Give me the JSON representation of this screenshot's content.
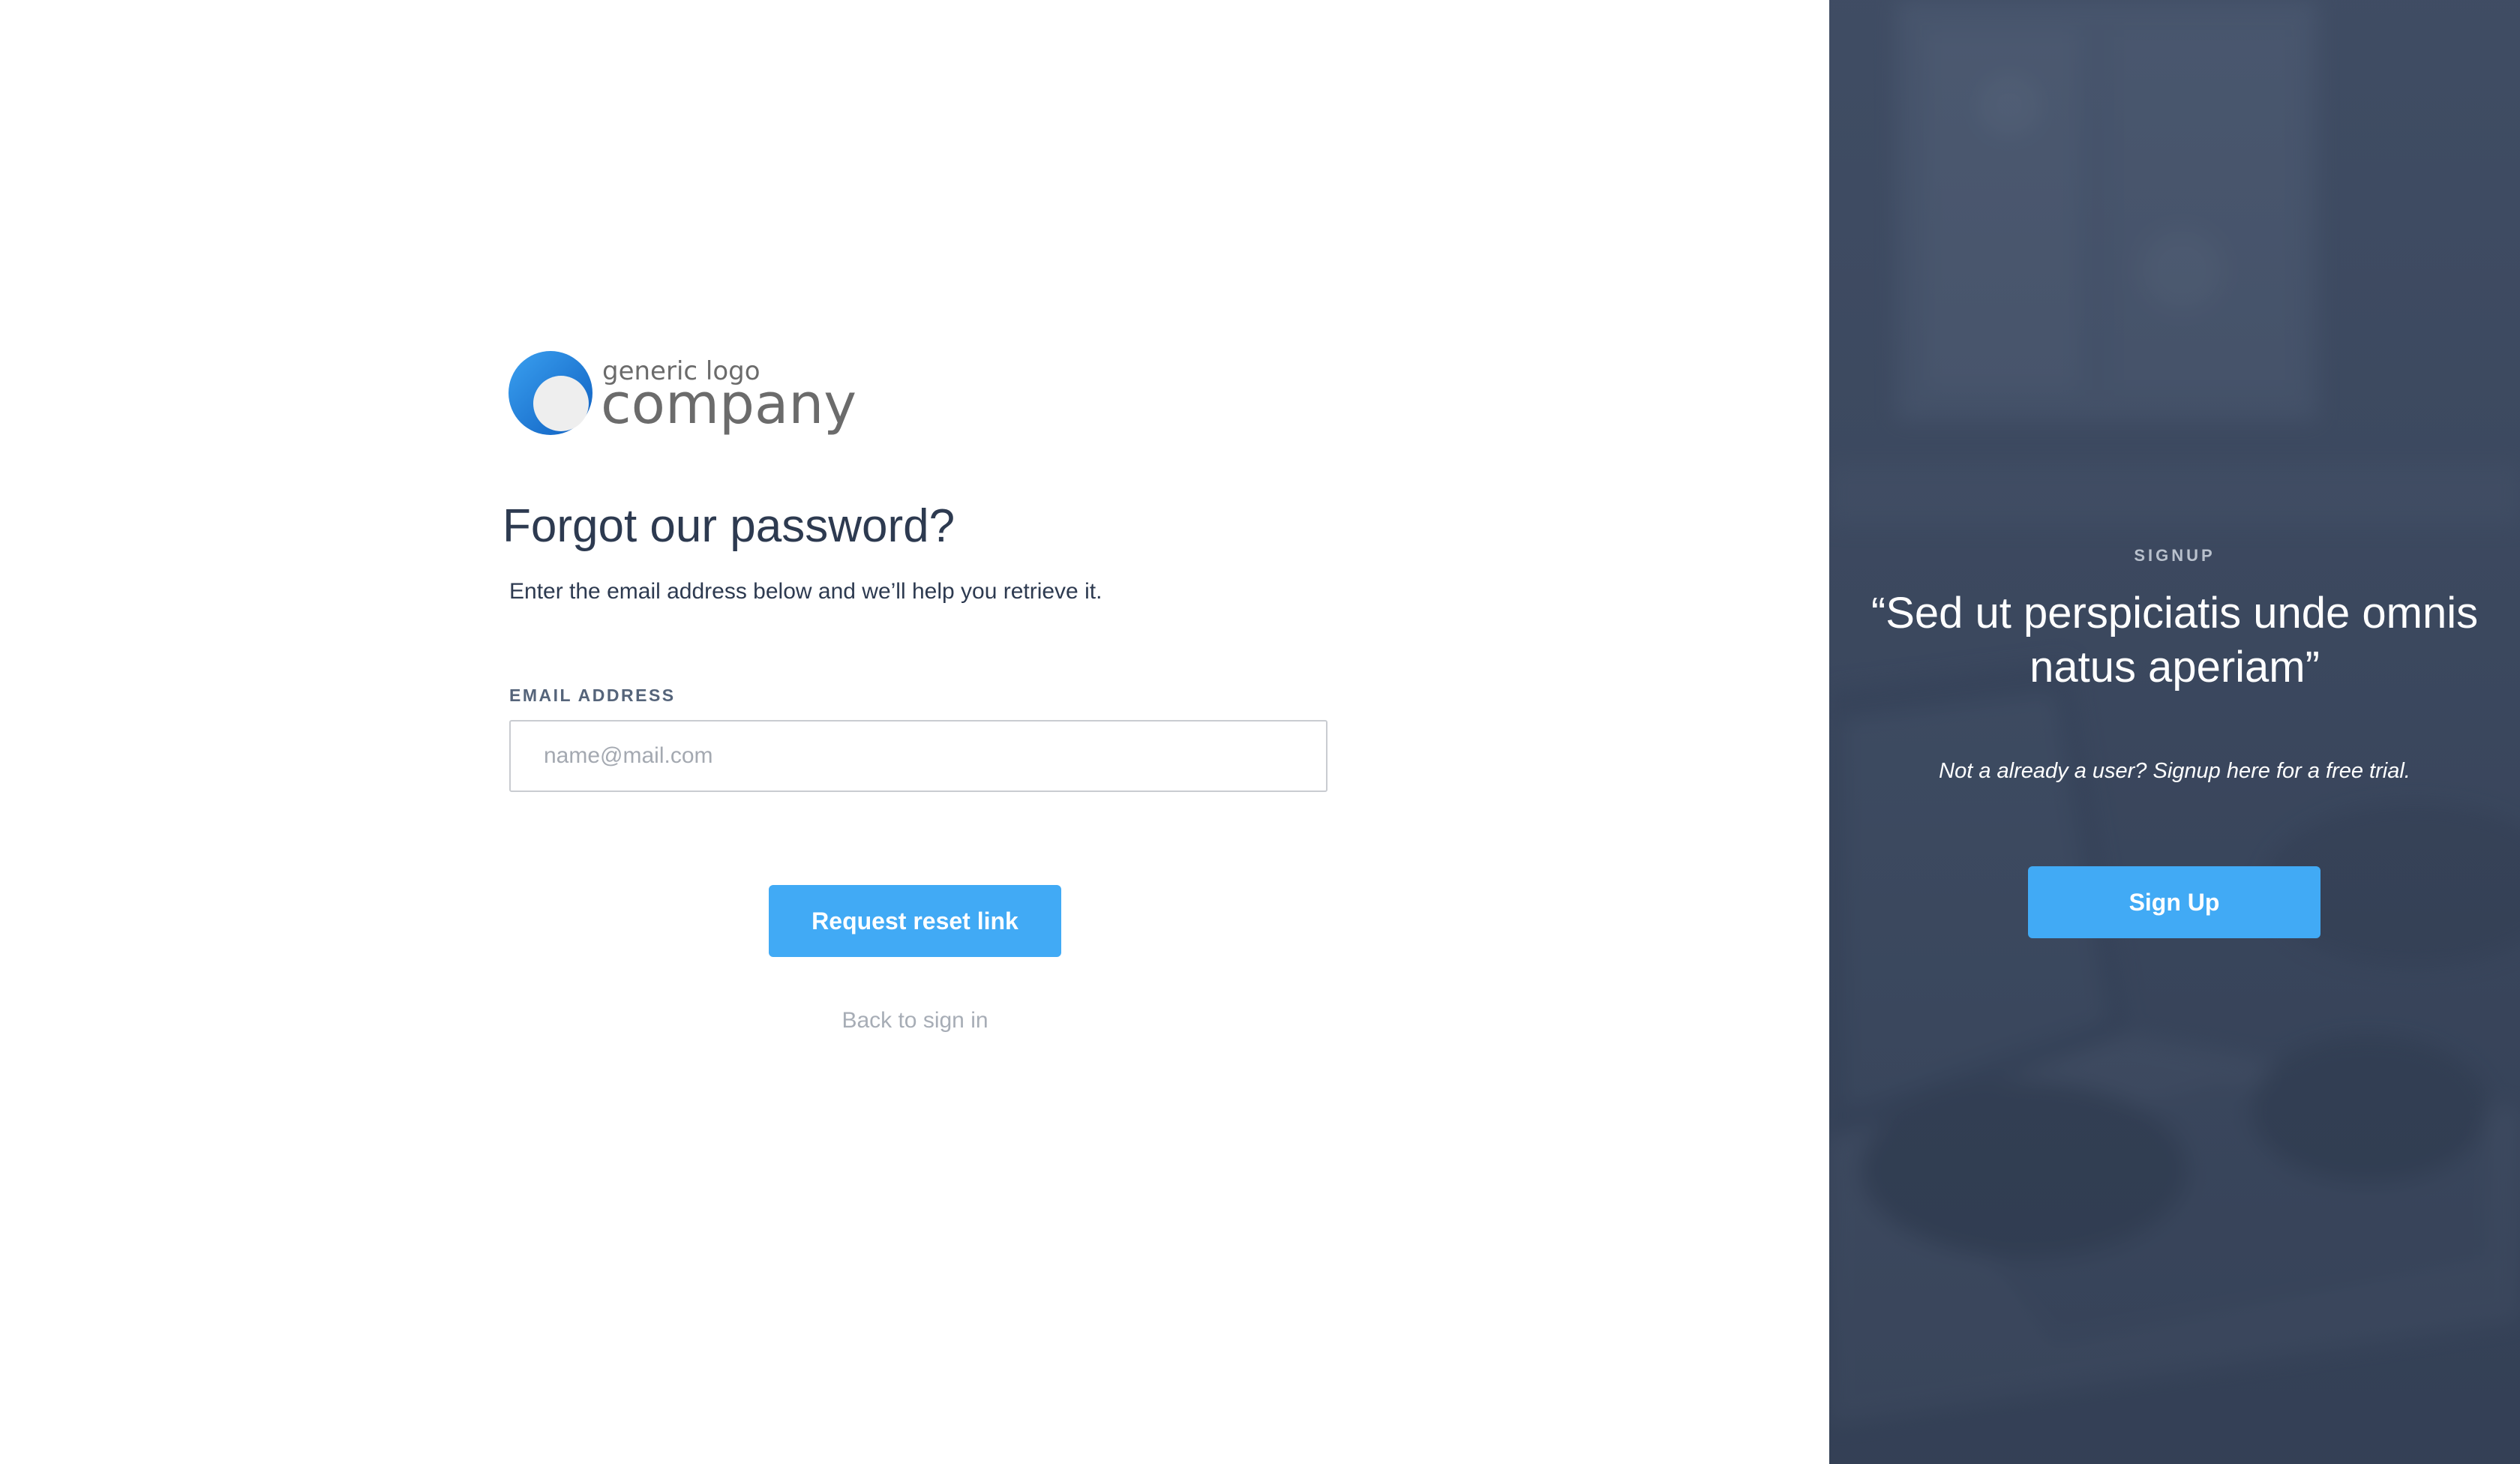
{
  "logo": {
    "small_text": "generic logo",
    "big_text": "company"
  },
  "form": {
    "title": "Forgot our password?",
    "subtitle": "Enter the email address below and we’ll help you retrieve it.",
    "email_label": "EMAIL ADDRESS",
    "email_placeholder": "name@mail.com",
    "email_value": "",
    "submit_label": "Request reset link",
    "back_link": "Back to sign in"
  },
  "signup_panel": {
    "eyebrow": "SIGNUP",
    "quote": "“Sed ut perspiciatis unde omnis natus aperiam”",
    "cta_text": "Not a already a user? Signup here for a free trial.",
    "button_label": "Sign Up"
  },
  "colors": {
    "accent": "#41aaf5",
    "heading": "#2d3a50",
    "panel_bg": "#3a475d",
    "muted_link": "#a7adb6"
  },
  "icons": {
    "logo_mark": "logo-circle-icon"
  }
}
